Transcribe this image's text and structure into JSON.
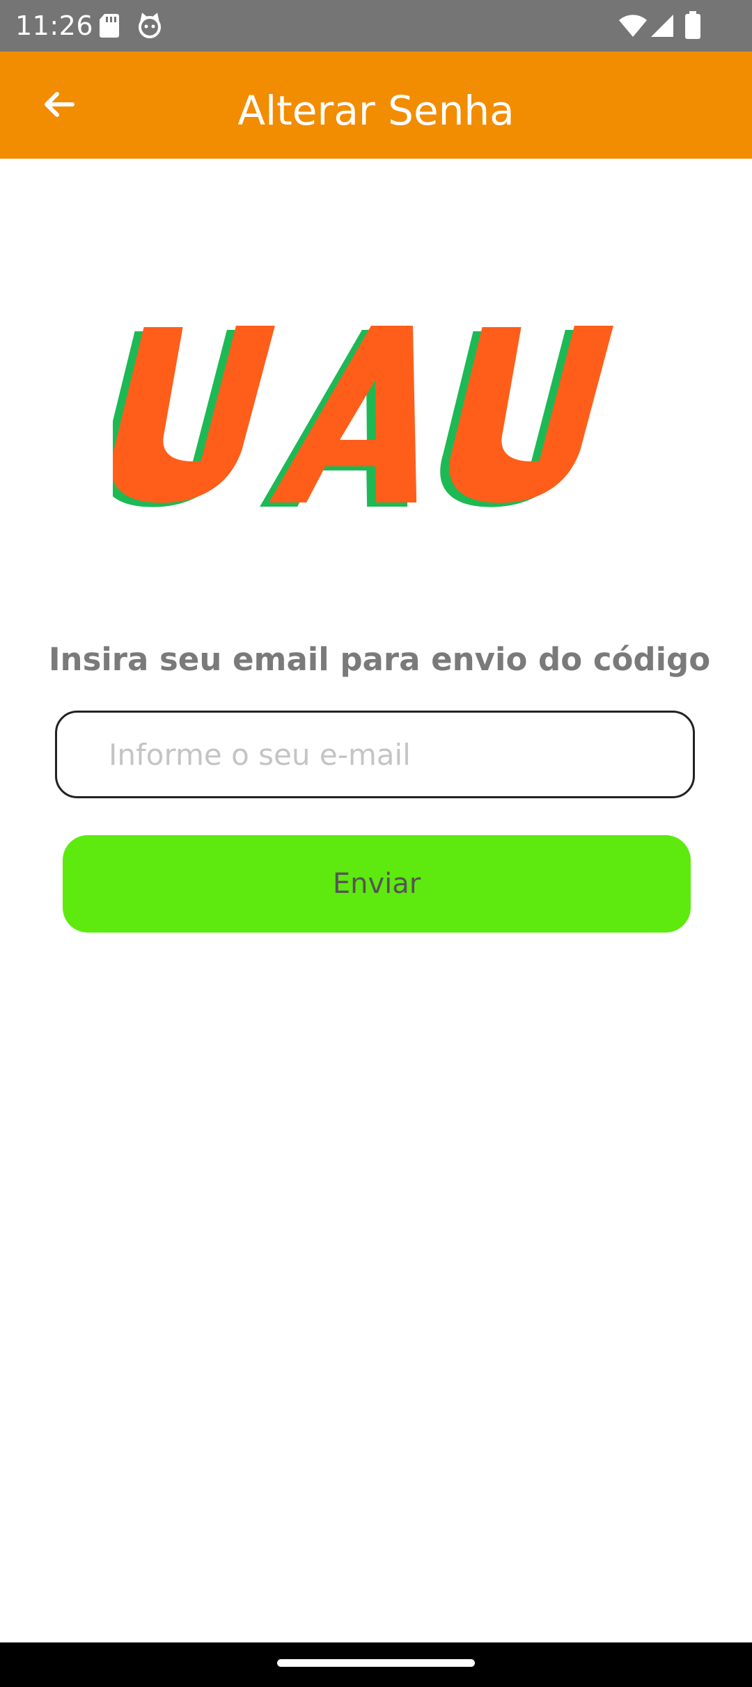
{
  "status_bar": {
    "time": "11:26",
    "icons": [
      "sd-card-icon",
      "cat-face-icon",
      "wifi-icon",
      "signal-icon",
      "battery-icon"
    ]
  },
  "app_bar": {
    "title": "Alterar Senha",
    "back_icon": "arrow-back-icon",
    "color": "#F28C00"
  },
  "logo": {
    "text": "UAU",
    "colors": {
      "primary": "#FF5E1A",
      "shadow": "#1DB954"
    }
  },
  "form": {
    "prompt": "Insira seu email para envio do código",
    "email_placeholder": "Informe o seu e-mail",
    "email_value": "",
    "submit_label": "Enviar",
    "submit_color": "#5EEA0E"
  }
}
